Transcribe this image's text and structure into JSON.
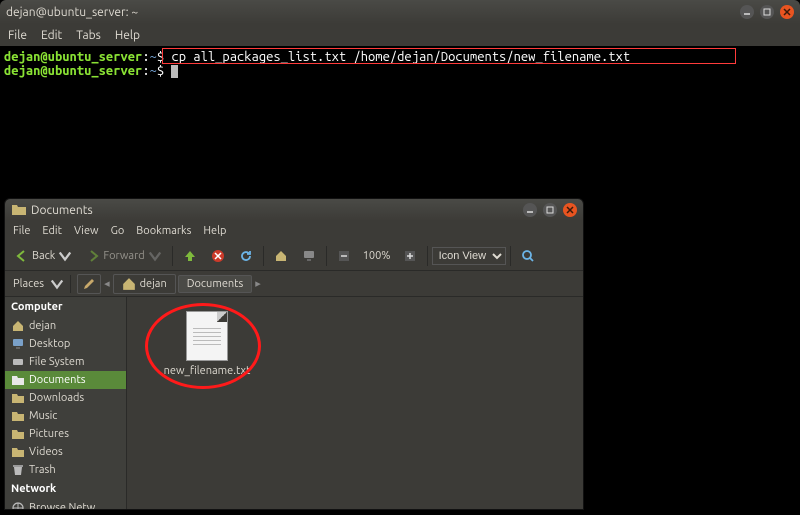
{
  "terminal": {
    "title": "dejan@ubuntu_server: ~",
    "menu": {
      "file": "File",
      "edit": "Edit",
      "tabs": "Tabs",
      "help": "Help"
    },
    "prompt_user": "dejan@ubuntu_server",
    "prompt_sep": ":",
    "prompt_path": "~",
    "prompt_symbol": "$",
    "command": "cp all_packages_list.txt /home/dejan/Documents/new_filename.txt"
  },
  "filemanager": {
    "title": "Documents",
    "menu": {
      "file": "File",
      "edit": "Edit",
      "view": "View",
      "go": "Go",
      "bookmarks": "Bookmarks",
      "help": "Help"
    },
    "toolbar": {
      "back": "Back",
      "forward": "Forward",
      "zoom": "100%",
      "viewmode": "Icon View"
    },
    "location": {
      "places_label": "Places",
      "crumbs": [
        "dejan",
        "Documents"
      ]
    },
    "sidebar": {
      "computer": "Computer",
      "items": [
        {
          "label": "dejan",
          "icon": "home"
        },
        {
          "label": "Desktop",
          "icon": "desktop"
        },
        {
          "label": "File System",
          "icon": "drive"
        },
        {
          "label": "Documents",
          "icon": "folder",
          "active": true
        },
        {
          "label": "Downloads",
          "icon": "folder"
        },
        {
          "label": "Music",
          "icon": "folder"
        },
        {
          "label": "Pictures",
          "icon": "folder"
        },
        {
          "label": "Videos",
          "icon": "folder"
        },
        {
          "label": "Trash",
          "icon": "trash"
        }
      ],
      "network": "Network",
      "network_items": [
        {
          "label": "Browse Netw…",
          "icon": "network"
        }
      ]
    },
    "file": {
      "name": "new_filename.txt"
    }
  }
}
